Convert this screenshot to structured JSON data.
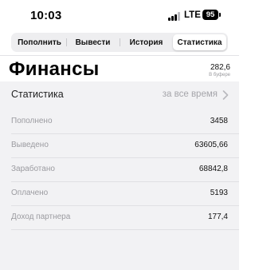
{
  "status_bar": {
    "time": "10:03",
    "network": "LTE",
    "battery": "95"
  },
  "tabs": [
    {
      "label": "Пополнить",
      "active": false
    },
    {
      "label": "Вывести",
      "active": false
    },
    {
      "label": "История",
      "active": false
    },
    {
      "label": "Статистика",
      "active": true
    }
  ],
  "header": {
    "title": "Финансы",
    "balance": "282,6",
    "balance_caption": "В буфере"
  },
  "statistics": {
    "label": "Статистика",
    "period": "за все время",
    "rows": [
      {
        "label": "Пополнено",
        "value": "3458"
      },
      {
        "label": "Выведено",
        "value": "63605,66"
      },
      {
        "label": "Заработано",
        "value": "68842,8"
      },
      {
        "label": "Оплачено",
        "value": "5193"
      },
      {
        "label": "Доход партнера",
        "value": "177,4"
      }
    ]
  },
  "icons": {
    "signal": "cellular-signal-icon",
    "battery": "battery-icon",
    "chevron": "chevron-right-icon"
  },
  "colors": {
    "background": "#f2f2f4",
    "secondary_text": "#9b9ba0",
    "segment_bg": "#eeeef0"
  }
}
